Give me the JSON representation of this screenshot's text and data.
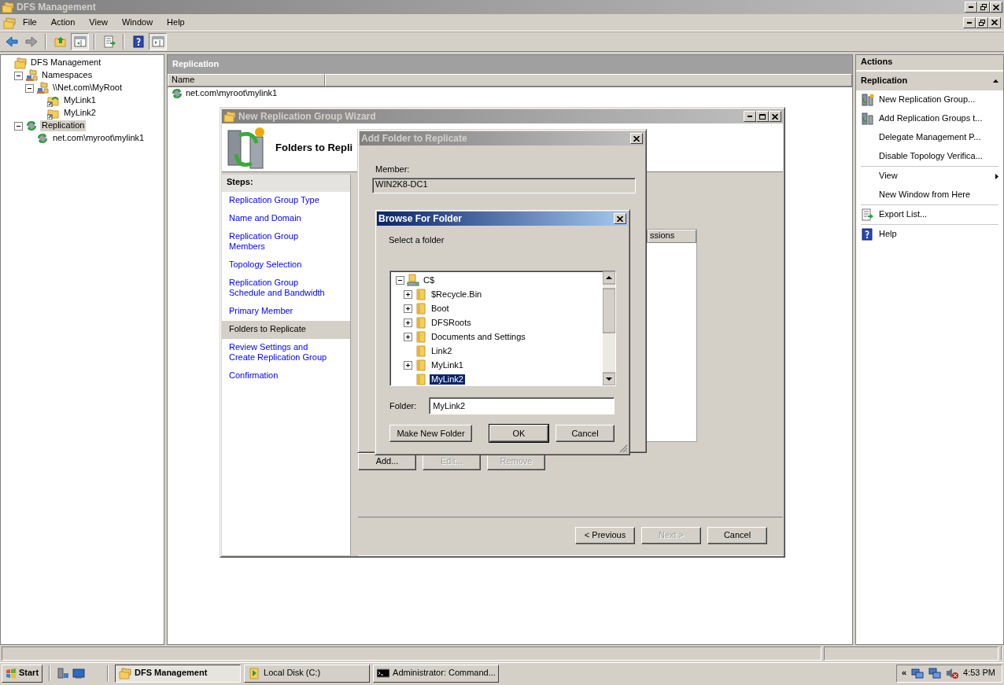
{
  "window": {
    "title": "DFS Management"
  },
  "menu": [
    {
      "label": "File"
    },
    {
      "label": "Action"
    },
    {
      "label": "View"
    },
    {
      "label": "Window"
    },
    {
      "label": "Help"
    }
  ],
  "toolbar": [
    {
      "buttons": [
        {
          "kind": "back",
          "on": false
        },
        {
          "kind": "forward",
          "on": false
        }
      ]
    },
    {
      "buttons": [
        {
          "kind": "up",
          "on": false
        },
        {
          "kind": "tree",
          "on": true
        }
      ]
    },
    {
      "buttons": [
        {
          "kind": "export",
          "on": false
        }
      ]
    },
    {
      "buttons": [
        {
          "kind": "help",
          "on": false
        },
        {
          "kind": "actions",
          "on": true
        }
      ]
    }
  ],
  "tree": [
    {
      "label": "DFS Management",
      "kind": "root",
      "selected": false,
      "children": [
        {
          "label": "Namespaces",
          "kind": "namespaces",
          "selected": false,
          "expanded": true,
          "children": [
            {
              "label": "\\\\Net.com\\MyRoot",
              "kind": "namespace",
              "selected": false,
              "expanded": true,
              "children": [
                {
                  "label": "MyLink1",
                  "kind": "link-sync",
                  "selected": false
                },
                {
                  "label": "MyLink2",
                  "kind": "link",
                  "selected": false
                }
              ]
            }
          ]
        },
        {
          "label": "Replication",
          "kind": "replication",
          "selected": true,
          "expanded": true,
          "children": [
            {
              "label": "net.com\\myroot\\mylink1",
              "kind": "group",
              "selected": false
            }
          ]
        }
      ]
    }
  ],
  "center": {
    "title": "Replication",
    "columns": [
      "Name"
    ],
    "rows": [
      {
        "name": "net.com\\myroot\\mylink1"
      }
    ]
  },
  "actions": {
    "title": "Actions",
    "section": "Replication",
    "expanded": true,
    "items": [
      {
        "label": "New Replication Group...",
        "kind": "new",
        "separator_before": false
      },
      {
        "label": "Add Replication Groups t...",
        "kind": "add",
        "separator_before": false
      },
      {
        "label": "Delegate Management P...",
        "kind": "plain",
        "separator_before": false
      },
      {
        "label": "Disable Topology Verifica...",
        "kind": "plain",
        "separator_before": false
      },
      {
        "label": "View",
        "kind": "submenu",
        "separator_before": true
      },
      {
        "label": "New Window from Here",
        "kind": "plain",
        "separator_before": false
      },
      {
        "label": "Export List...",
        "kind": "export",
        "separator_before": true
      },
      {
        "label": "Help",
        "kind": "help",
        "separator_before": true
      }
    ]
  },
  "wizard": {
    "title": "New Replication Group Wizard",
    "heading": "Folders to Repli",
    "steps_title": "Steps:",
    "steps": [
      {
        "label": "Replication Group Type",
        "selected": false
      },
      {
        "label": "Name and Domain",
        "selected": false
      },
      {
        "label": "Replication Group Members",
        "selected": false
      },
      {
        "label": "Topology Selection",
        "selected": false
      },
      {
        "label": "Replication Group Schedule and Bandwidth",
        "selected": false
      },
      {
        "label": "Primary Member",
        "selected": false
      },
      {
        "label": "Folders to Replicate",
        "selected": true
      },
      {
        "label": "Review Settings and Create Replication Group",
        "selected": false
      },
      {
        "label": "Confirmation",
        "selected": false
      }
    ],
    "list_column": "ssions",
    "list_buttons": [
      {
        "label": "Add...",
        "disabled": false
      },
      {
        "label": "Edit...",
        "disabled": true
      },
      {
        "label": "Remove",
        "disabled": true
      }
    ],
    "buttons": [
      {
        "label": "< Previous",
        "disabled": false
      },
      {
        "label": "Next >",
        "disabled": true
      },
      {
        "label": "Cancel",
        "disabled": false
      }
    ]
  },
  "add_dialog": {
    "title": "Add Folder to Replicate",
    "member_label": "Member:",
    "member_value": "WIN2K8-DC1"
  },
  "browse": {
    "title": "Browse For Folder",
    "prompt": "Select a folder",
    "tree": [
      {
        "label": "C$",
        "kind": "drive",
        "expanded": true,
        "selected": false,
        "children": [
          {
            "label": "$Recycle.Bin",
            "kind": "folder",
            "expanded": false,
            "selected": false
          },
          {
            "label": "Boot",
            "kind": "folder",
            "expanded": false,
            "selected": false
          },
          {
            "label": "DFSRoots",
            "kind": "folder",
            "expanded": false,
            "selected": false
          },
          {
            "label": "Documents and Settings",
            "kind": "folder",
            "expanded": false,
            "selected": false
          },
          {
            "label": "Link2",
            "kind": "folder",
            "selected": false
          },
          {
            "label": "MyLink1",
            "kind": "folder",
            "expanded": false,
            "selected": false
          },
          {
            "label": "MyLink2",
            "kind": "folder",
            "selected": true
          }
        ]
      }
    ],
    "folder_label": "Folder:",
    "folder_value": "MyLink2",
    "buttons": [
      {
        "label": "Make New Folder",
        "default": false
      },
      {
        "label": "OK",
        "default": true
      },
      {
        "label": "Cancel",
        "default": false
      }
    ]
  },
  "taskbar": {
    "start": "Start",
    "tasks": [
      {
        "label": "DFS Management",
        "kind": "mmc",
        "selected": true
      },
      {
        "label": "Local Disk (C:)",
        "kind": "explorer",
        "selected": false
      },
      {
        "label": "Administrator: Command...",
        "kind": "console",
        "selected": false
      }
    ],
    "tray_toggle": "«",
    "clock": "4:53 PM"
  }
}
